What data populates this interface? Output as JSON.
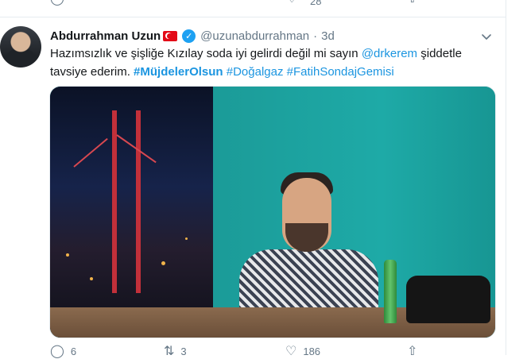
{
  "previous_tweet": {
    "like_count": "28"
  },
  "tweet": {
    "display_name": "Abdurrahman Uzun",
    "handle": "@uzunabdurrahman",
    "separator": "·",
    "time": "3d",
    "text_parts": {
      "p1": "Hazımsızlık ve şişliğe Kızılay soda iyi gelirdi değil mi sayın ",
      "mention": "@drkerem",
      "p2": " şiddetle tavsiye ederim. ",
      "tag1": "#MüjdelerOlsun",
      "sp1": " ",
      "tag2": "#Doğalgaz",
      "sp2": " ",
      "tag3": "#FatihSondajGemisi"
    },
    "counts": {
      "replies": "6",
      "retweets": "3",
      "likes": "186"
    }
  },
  "colors": {
    "accent": "#1b95e0",
    "verified": "#1da1f2",
    "muted": "#657786"
  },
  "icons": [
    "reply-icon",
    "retweet-icon",
    "like-icon",
    "share-icon",
    "verified-icon",
    "turkey-flag-icon",
    "chevron-down-icon"
  ]
}
